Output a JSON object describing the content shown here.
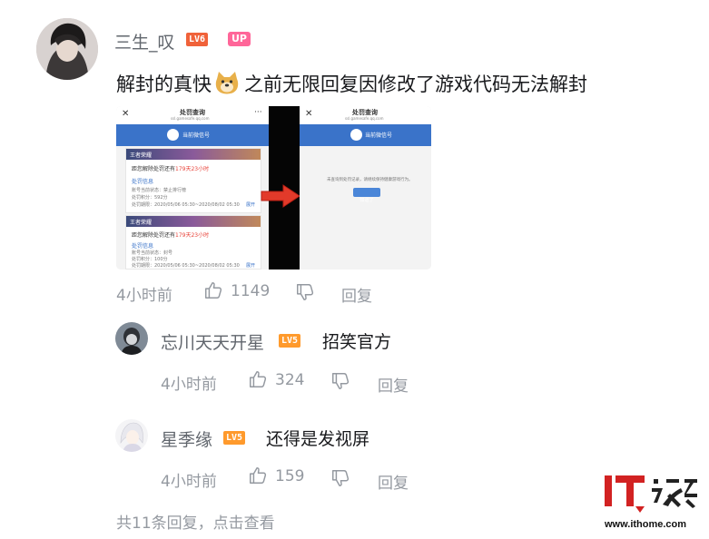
{
  "comment": {
    "username": "三生_叹",
    "level": "LV6",
    "up_badge": "UP",
    "text_before": "解封的真快",
    "text_after": "之前无限回复因修改了游戏代码无法解封",
    "time": "4小时前",
    "likes": "1149",
    "reply_label": "回复",
    "attachment": {
      "left": {
        "title": "处罚查询",
        "url": "ssl.gamesafe.qq.com",
        "account_label": "当前微信号",
        "cards": [
          {
            "game": "王者荣耀",
            "notice_prefix": "距您解除处罚还有",
            "notice_time": "179天23小时",
            "section": "处罚信息",
            "reason": "账号当前状态：禁止排行榜",
            "score": "处罚积分：592分",
            "period": "处罚期限：2020/05/06 05:30~2020/08/02 05:30",
            "more": "展开"
          },
          {
            "game": "王者荣耀",
            "notice_prefix": "距您解除处罚还有",
            "notice_time": "179天23小时",
            "section": "处罚信息",
            "reason": "账号当前状态：封号",
            "score": "处罚积分：100分",
            "period": "处罚期限：2020/05/06 05:30~2020/08/02 05:30",
            "more": "展开"
          }
        ]
      },
      "right": {
        "title": "处罚查询",
        "url": "ssl.gamesafe.qq.com",
        "account_label": "当前微信号",
        "message": "未查询到处罚记录，请继续保持健康游戏行为。",
        "button": "知道了"
      }
    }
  },
  "replies": [
    {
      "username": "忘川天天开星",
      "level": "LV5",
      "text": "招笑官方",
      "time": "4小时前",
      "likes": "324",
      "reply_label": "回复"
    },
    {
      "username": "星季缘",
      "level": "LV5",
      "text": "还得是发视屏",
      "time": "4小时前",
      "likes": "159",
      "reply_label": "回复"
    }
  ],
  "more_replies": "共11条回复，点击查看",
  "watermark": {
    "logo_text": "IT之家",
    "url": "www.ithome.com"
  },
  "colors": {
    "level6": "#f0623a",
    "level5": "#ff9a2c",
    "up_badge": "#ff6699",
    "meta_gray": "#9499a0",
    "ithome_red": "#d22222"
  }
}
